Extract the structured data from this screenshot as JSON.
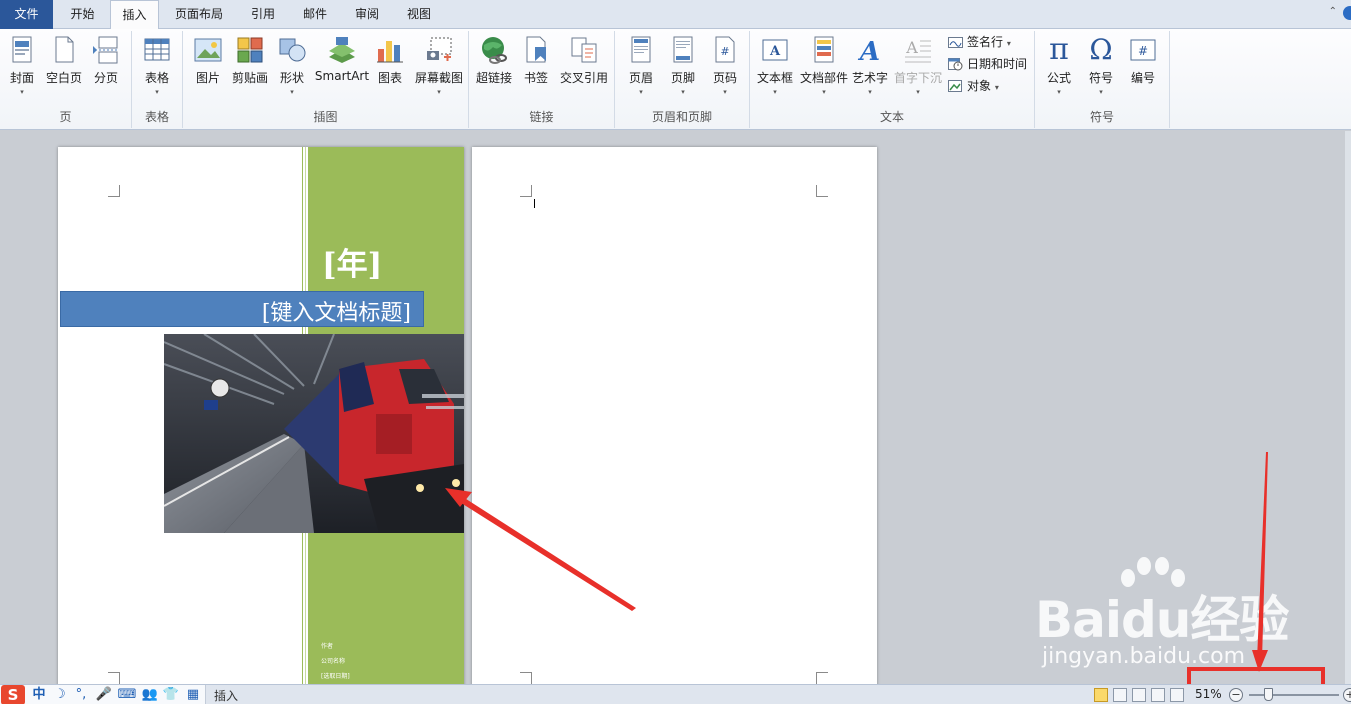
{
  "tabs": [
    {
      "label": "文件"
    },
    {
      "label": "开始"
    },
    {
      "label": "插入"
    },
    {
      "label": "页面布局"
    },
    {
      "label": "引用"
    },
    {
      "label": "邮件"
    },
    {
      "label": "审阅"
    },
    {
      "label": "视图"
    }
  ],
  "active_tab": "插入",
  "help": {
    "caret": "⌃"
  },
  "ribbon": {
    "groups": {
      "pages": {
        "label": "页",
        "buttons": [
          "封面",
          "空白页",
          "分页"
        ]
      },
      "tables": {
        "label": "表格",
        "buttons": [
          "表格"
        ]
      },
      "illustrations": {
        "label": "插图",
        "buttons": [
          "图片",
          "剪贴画",
          "形状",
          "SmartArt",
          "图表",
          "屏幕截图"
        ]
      },
      "links": {
        "label": "链接",
        "buttons": [
          "超链接",
          "书签",
          "交叉引用"
        ]
      },
      "header_footer": {
        "label": "页眉和页脚",
        "buttons": [
          "页眉",
          "页脚",
          "页码"
        ]
      },
      "text": {
        "label": "文本",
        "buttons": [
          "文本框",
          "文档部件",
          "艺术字",
          "首字下沉"
        ],
        "small_buttons": [
          "签名行",
          "日期和时间",
          "对象"
        ]
      },
      "symbols": {
        "label": "符号",
        "buttons": [
          "公式",
          "符号",
          "编号"
        ],
        "glyphs": [
          "π",
          "Ω",
          "#"
        ]
      }
    },
    "dropdown_marker": "▾"
  },
  "document": {
    "page1": {
      "year_placeholder": "[年]",
      "title_placeholder": "[键入文档标题]",
      "meta_lines": [
        "作者",
        "公司名称",
        "[选取日期]"
      ]
    }
  },
  "watermark": {
    "line1": "Baidu经验",
    "line2": "jingyan.baidu.com"
  },
  "statusbar": {
    "ime_logo": "S",
    "ime_icons": [
      "中",
      "☽",
      "°,",
      "🎤",
      "⌨",
      "👥",
      "👕",
      "▦"
    ],
    "mode": "插入",
    "zoom": "51%",
    "zoom_level": 0.51,
    "zoom_minus": "−",
    "zoom_plus": "+"
  },
  "colors": {
    "file_tab": "#2b579a",
    "green_band": "#9bbb59",
    "title_bar": "#4f81bd",
    "annotation": "#e8302a"
  }
}
